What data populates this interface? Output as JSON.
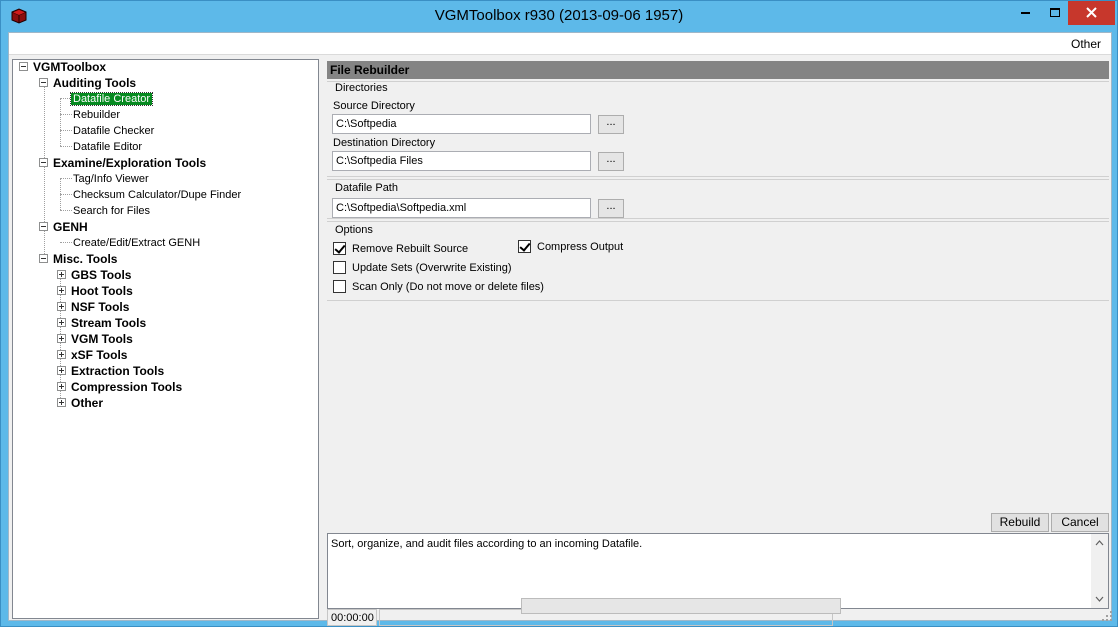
{
  "window": {
    "title": "VGMToolbox r930 (2013-09-06 1957)"
  },
  "menu": {
    "other": "Other"
  },
  "tree": {
    "root": "VGMToolbox",
    "auditing": "Auditing Tools",
    "datafile_creator": "Datafile Creator",
    "rebuilder": "Rebuilder",
    "datafile_checker": "Datafile Checker",
    "datafile_editor": "Datafile Editor",
    "examine": "Examine/Exploration Tools",
    "tag_info_viewer": "Tag/Info Viewer",
    "checksum_calc": "Checksum Calculator/Dupe Finder",
    "search_files": "Search for Files",
    "genh": "GENH",
    "create_genh": "Create/Edit/Extract GENH",
    "misc": "Misc. Tools",
    "gbs": "GBS Tools",
    "hoot": "Hoot Tools",
    "nsf": "NSF Tools",
    "stream": "Stream Tools",
    "vgm": "VGM Tools",
    "xsf": "xSF Tools",
    "extraction": "Extraction Tools",
    "compression": "Compression Tools",
    "other": "Other"
  },
  "panel": {
    "title": "File Rebuilder",
    "directories_group": "Directories",
    "source_label": "Source Directory",
    "source_value": "C:\\Softpedia",
    "dest_label": "Destination Directory",
    "dest_value": "C:\\Softpedia Files",
    "datafile_label": "Datafile Path",
    "datafile_value": "C:\\Softpedia\\Softpedia.xml",
    "browse_label": "...",
    "options_group": "Options",
    "opt_remove": "Remove Rebuilt Source",
    "opt_compress": "Compress Output",
    "opt_update": "Update Sets (Overwrite Existing)",
    "opt_scan": "Scan Only (Do not move or delete files)",
    "rebuild_button": "Rebuild",
    "cancel_button": "Cancel",
    "description": "Sort, organize, and audit files according to an incoming Datafile.",
    "elapsed": "00:00:00"
  },
  "colors": {
    "window_frame": "#5db9e9",
    "close_button": "#c7372c",
    "selection": "#068a20",
    "header": "#848484"
  }
}
